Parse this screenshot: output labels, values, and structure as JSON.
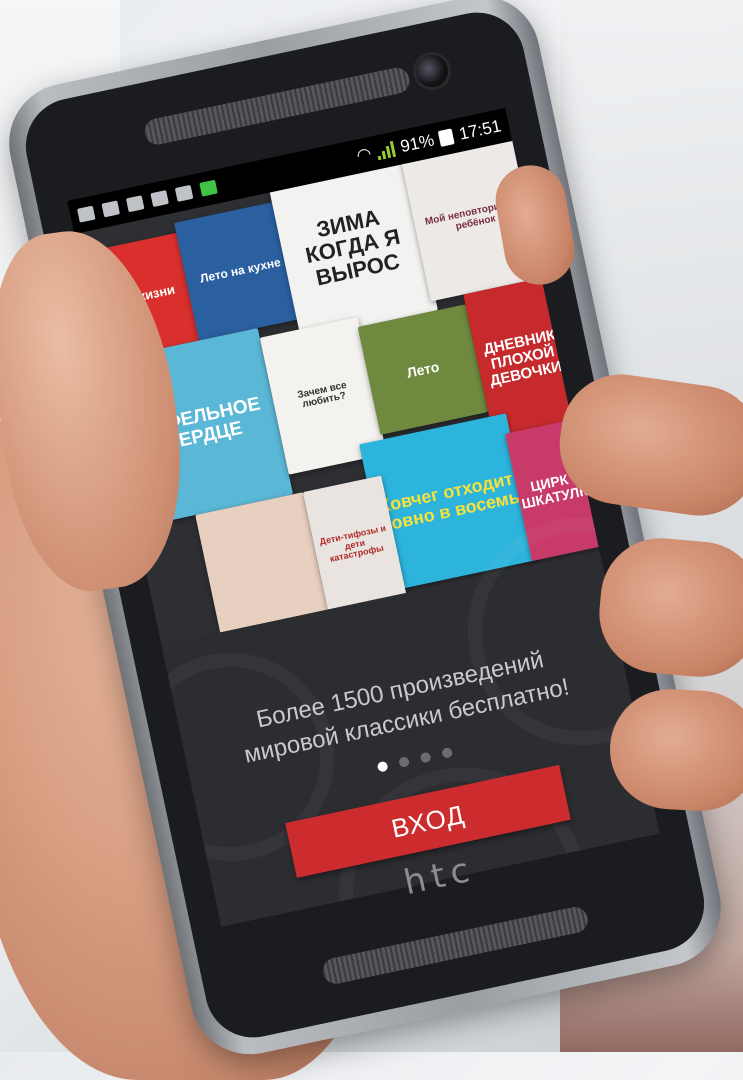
{
  "statusbar": {
    "battery_percent": "91%",
    "time": "17:51",
    "icons": [
      "notification-icon",
      "usb-icon",
      "image-icon",
      "mail-icon",
      "download-icon",
      "app-icon",
      "wifi-icon",
      "signal-icon",
      "battery-icon"
    ]
  },
  "covers": [
    {
      "title": "Цвет жизни",
      "bg": "#d9302e",
      "fg": "#fff"
    },
    {
      "title": "Лето на кухне",
      "bg": "#2a5fa0",
      "fg": "#fff"
    },
    {
      "title": "ЗИМА КОГДА Я ВЫРОС",
      "bg": "#f2f2f0",
      "fg": "#222"
    },
    {
      "title": "Мой неповторимый ребёнок",
      "bg": "#ece9e6",
      "fg": "#7a2d45"
    },
    {
      "title": "ВАФЕЛЬНОЕ СЕРДЦЕ",
      "bg": "#5ab7d6",
      "fg": "#fff"
    },
    {
      "title": "Зачем все любить?",
      "bg": "#f4f2ee",
      "fg": "#333"
    },
    {
      "title": "Лето",
      "bg": "#6f8a3e",
      "fg": "#fff"
    },
    {
      "title": "ДНЕВНИК ПЛОХОЙ ДЕВОЧКИ",
      "bg": "#c62a2c",
      "fg": "#fff"
    },
    {
      "title": "Ковчег отходит ровно в восемь",
      "bg": "#2db4dc",
      "fg": "#f7e23a"
    },
    {
      "title": "ЦИРК В ШКАТУЛКЕ",
      "bg": "#c73a6a",
      "fg": "#fff"
    },
    {
      "title": "",
      "bg": "#e8d0c0",
      "fg": "#333"
    },
    {
      "title": "Дети-тифозы и дети катастрофы",
      "bg": "#e9e4e0",
      "fg": "#b02a2a"
    }
  ],
  "promo": {
    "line1": "Более 1500 произведений",
    "line2": "мировой классики бесплатно!"
  },
  "pager": {
    "count": 4,
    "active": 0
  },
  "login_label": "ВХОД",
  "brand": "htc",
  "colors": {
    "accent": "#cc2c2e",
    "overlay_bg": "#2c2d31"
  }
}
